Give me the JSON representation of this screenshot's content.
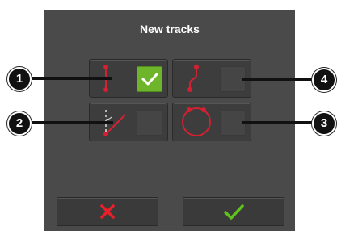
{
  "dialog": {
    "title": "New tracks"
  },
  "options": [
    {
      "id": "ab-line",
      "icon": "straight-line-track-icon",
      "callout": "1",
      "checked": true
    },
    {
      "id": "identical-curve",
      "icon": "curved-track-icon",
      "callout": "4",
      "checked": false
    },
    {
      "id": "a-plus",
      "icon": "a-plus-angle-track-icon",
      "callout": "2",
      "checked": false
    },
    {
      "id": "circle",
      "icon": "circle-track-icon",
      "callout": "3",
      "checked": false
    }
  ],
  "buttons": {
    "cancel_icon": "close-icon",
    "confirm_icon": "checkmark-icon"
  },
  "colors": {
    "accent_green": "#6fb52c",
    "track_red": "#d42030",
    "cancel_red": "#e8202a",
    "confirm_green": "#5ec21c"
  }
}
